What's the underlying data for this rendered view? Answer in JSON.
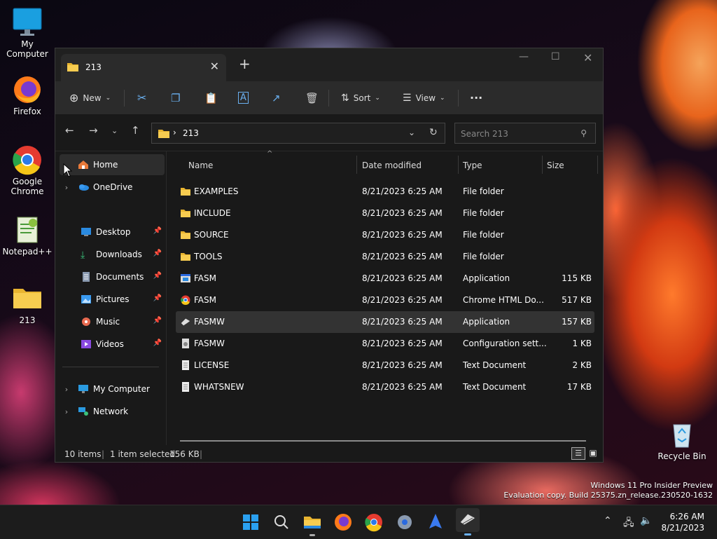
{
  "desktop": {
    "icons": [
      {
        "label": "My Computer"
      },
      {
        "label": "Firefox"
      },
      {
        "label": "Google Chrome"
      },
      {
        "label": "Notepad++"
      },
      {
        "label": "213"
      },
      {
        "label": "Recycle Bin"
      }
    ],
    "watermark_line1": "Windows 11 Pro Insider Preview",
    "watermark_line2": "Evaluation copy. Build 25375.zn_release.230520-1632"
  },
  "window": {
    "tab_title": "213",
    "toolbar": {
      "new": "New",
      "sort": "Sort",
      "view": "View",
      "more": "···"
    },
    "address": {
      "path": "213",
      "search_placeholder": "Search 213"
    },
    "nav": {
      "home": "Home",
      "onedrive": "OneDrive",
      "pinned": [
        "Desktop",
        "Downloads",
        "Documents",
        "Pictures",
        "Music",
        "Videos"
      ],
      "my_computer": "My Computer",
      "network": "Network"
    },
    "columns": {
      "name": "Name",
      "date": "Date modified",
      "type": "Type",
      "size": "Size"
    },
    "files": [
      {
        "name": "EXAMPLES",
        "date": "8/21/2023 6:25 AM",
        "type": "File folder",
        "size": "",
        "icon": "folder-icon"
      },
      {
        "name": "INCLUDE",
        "date": "8/21/2023 6:25 AM",
        "type": "File folder",
        "size": "",
        "icon": "folder-icon"
      },
      {
        "name": "SOURCE",
        "date": "8/21/2023 6:25 AM",
        "type": "File folder",
        "size": "",
        "icon": "folder-icon"
      },
      {
        "name": "TOOLS",
        "date": "8/21/2023 6:25 AM",
        "type": "File folder",
        "size": "",
        "icon": "folder-icon"
      },
      {
        "name": "FASM",
        "date": "8/21/2023 6:25 AM",
        "type": "Application",
        "size": "115 KB",
        "icon": "app-icon"
      },
      {
        "name": "FASM",
        "date": "8/21/2023 6:25 AM",
        "type": "Chrome HTML Do...",
        "size": "517 KB",
        "icon": "chrome-icon"
      },
      {
        "name": "FASMW",
        "date": "8/21/2023 6:25 AM",
        "type": "Application",
        "size": "157 KB",
        "icon": "fasmw-icon"
      },
      {
        "name": "FASMW",
        "date": "8/21/2023 6:25 AM",
        "type": "Configuration sett...",
        "size": "1 KB",
        "icon": "config-icon"
      },
      {
        "name": "LICENSE",
        "date": "8/21/2023 6:25 AM",
        "type": "Text Document",
        "size": "2 KB",
        "icon": "text-icon"
      },
      {
        "name": "WHATSNEW",
        "date": "8/21/2023 6:25 AM",
        "type": "Text Document",
        "size": "17 KB",
        "icon": "text-icon"
      }
    ],
    "status": {
      "items": "10 items",
      "selected": "1 item selected",
      "size": "156 KB"
    }
  },
  "taskbar": {
    "time": "6:26 AM",
    "date": "8/21/2023"
  }
}
